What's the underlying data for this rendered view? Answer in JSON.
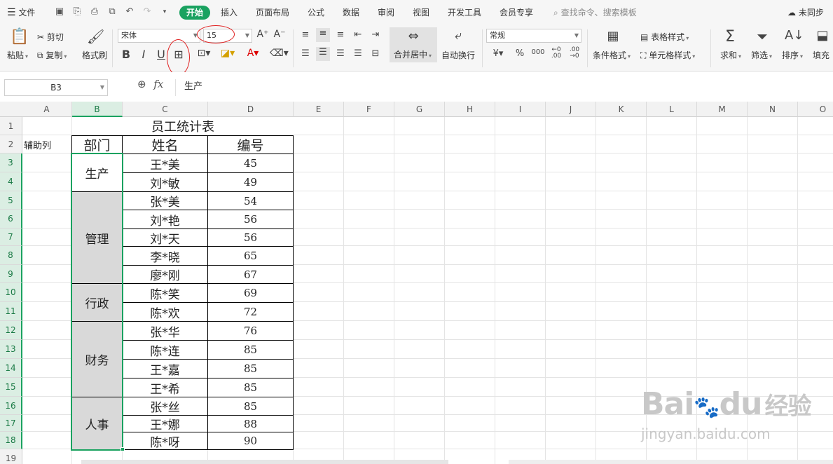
{
  "menubar": {
    "hamburger": "文件",
    "tabs": [
      "开始",
      "插入",
      "页面布局",
      "公式",
      "数据",
      "审阅",
      "视图",
      "开发工具",
      "会员专享"
    ],
    "search": "查找命令、搜索模板",
    "sync": "未同步"
  },
  "ribbon": {
    "paste": "粘贴",
    "cut": "剪切",
    "copy": "复制",
    "format_painter": "格式刷",
    "font_name": "宋体",
    "font_size": "15",
    "merge_center": "合并居中",
    "wrap": "自动换行",
    "number_format": "常规",
    "cond_format": "条件格式",
    "table_style": "表格样式",
    "cell_style": "单元格样式",
    "sum": "求和",
    "filter": "筛选",
    "sort": "排序",
    "fill": "填充"
  },
  "formula": {
    "name_box": "B3",
    "fx": "fx",
    "content": "生产"
  },
  "sheet": {
    "columns": [
      "A",
      "B",
      "C",
      "D",
      "E",
      "F",
      "G",
      "H",
      "I",
      "J",
      "K",
      "L",
      "M",
      "N",
      "O"
    ],
    "rows": [
      "1",
      "2",
      "3",
      "4",
      "5",
      "6",
      "7",
      "8",
      "9",
      "10",
      "11",
      "12",
      "13",
      "14",
      "15",
      "16",
      "17",
      "18",
      "19"
    ],
    "title": "员工统计表",
    "helper_label": "辅助列",
    "headers": [
      "部门",
      "姓名",
      "编号"
    ],
    "departments": [
      "生产",
      "管理",
      "行政",
      "财务",
      "人事"
    ],
    "names": [
      "王*美",
      "刘*敏",
      "张*美",
      "刘*艳",
      "刘*天",
      "李*晓",
      "廖*刚",
      "陈*笑",
      "陈*欢",
      "张*华",
      "陈*连",
      "王*嘉",
      "王*希",
      "张*丝",
      "王*娜",
      "陈*呀"
    ],
    "numbers": [
      "45",
      "49",
      "54",
      "56",
      "56",
      "65",
      "67",
      "69",
      "72",
      "76",
      "85",
      "85",
      "85",
      "85",
      "88",
      "90"
    ]
  },
  "watermark": {
    "brand_latin": "Bai",
    "brand_latin2": "du",
    "brand_cn": "经验",
    "url": "jingyan.baidu.com"
  },
  "colors": {
    "accent": "#1aa260",
    "annotation": "#e02020",
    "merged_fill": "#d9d9d9"
  }
}
